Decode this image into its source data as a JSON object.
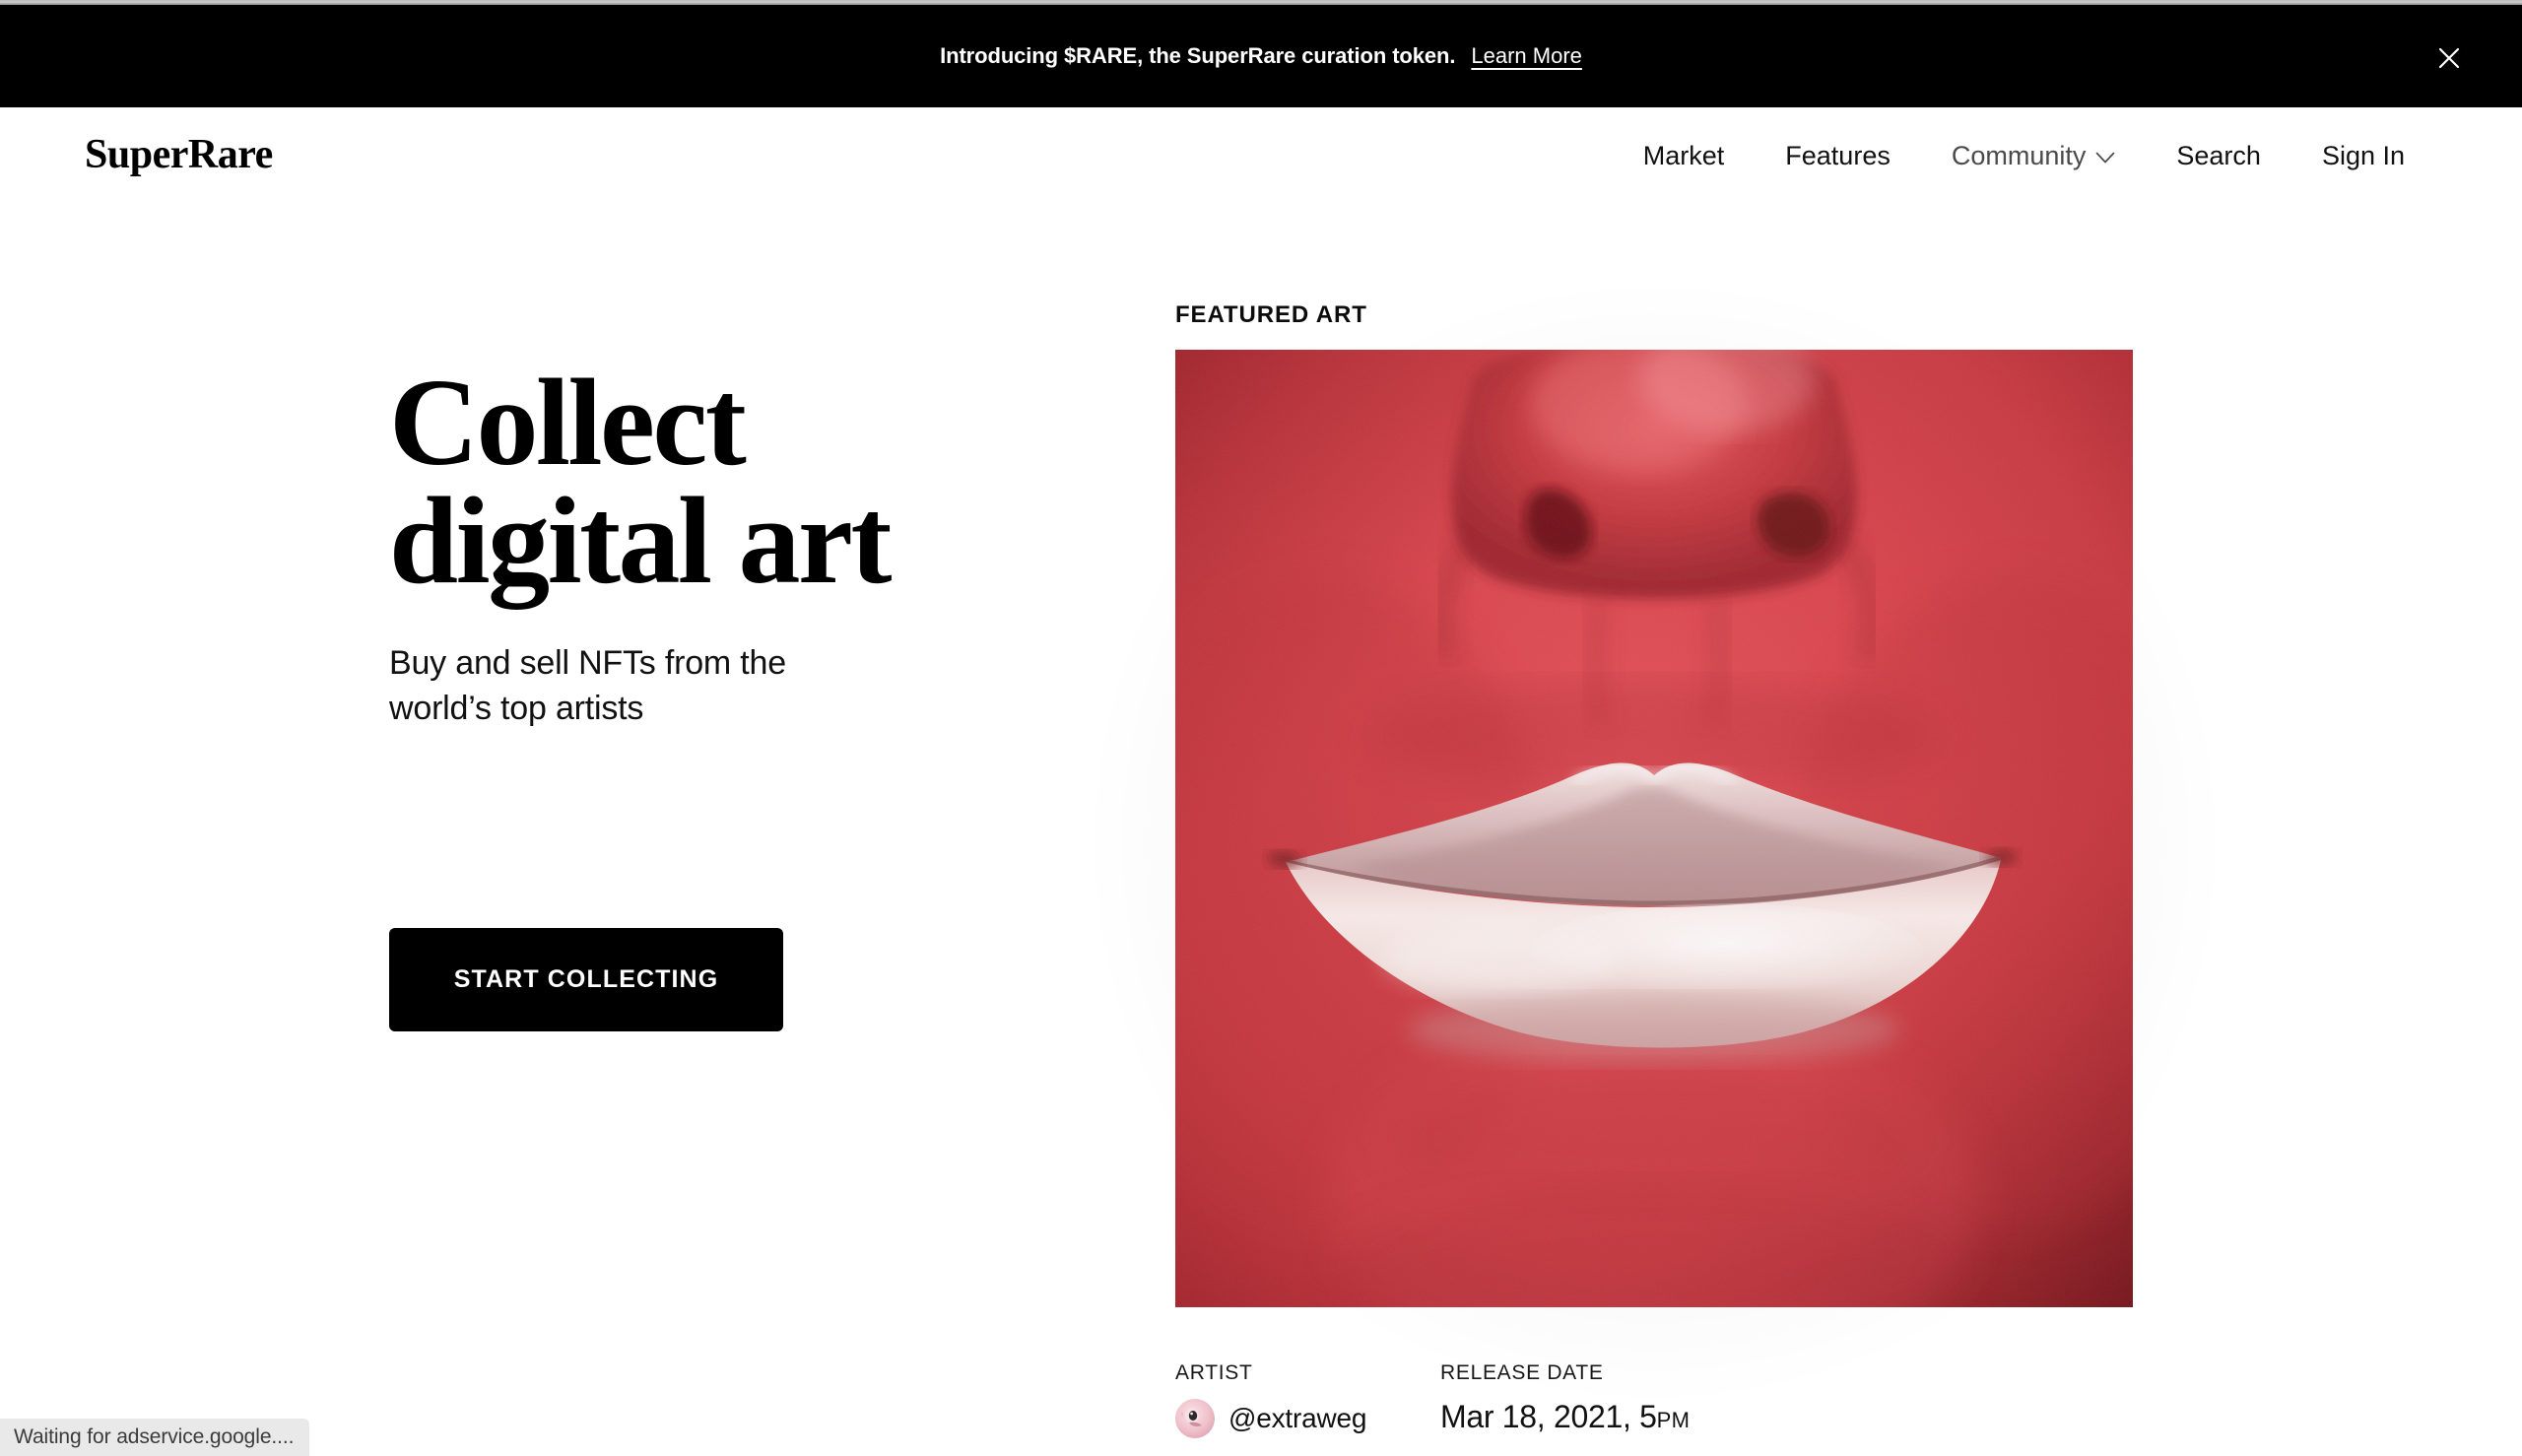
{
  "banner": {
    "text": "Introducing $RARE, the SuperRare curation token.",
    "link_label": "Learn More",
    "close_icon": "close-icon",
    "background": "#000000",
    "foreground": "#ffffff"
  },
  "header": {
    "logo": "SuperRare",
    "nav": [
      {
        "label": "Market",
        "icon": null,
        "muted": false
      },
      {
        "label": "Features",
        "icon": null,
        "muted": false
      },
      {
        "label": "Community",
        "icon": "chevron-down-icon",
        "muted": true
      },
      {
        "label": "Search",
        "icon": null,
        "muted": false
      },
      {
        "label": "Sign In",
        "icon": null,
        "muted": false
      }
    ]
  },
  "hero": {
    "title_line1": "Collect",
    "title_line2": "digital art",
    "subtitle_line1": "Buy and sell NFTs from the",
    "subtitle_line2": "world’s top artists",
    "cta_label": "START COLLECTING"
  },
  "featured": {
    "label": "FEATURED ART",
    "artwork_alt": "Close-up of a face in red tones showing nose and pale lips",
    "artist_label": "ARTIST",
    "artist_handle": "@extraweg",
    "release_label": "RELEASE DATE",
    "release_date": "Mar 18, 2021, 5",
    "release_ampm": "PM"
  },
  "status_bar": {
    "text": "Waiting for adservice.google...."
  },
  "colors": {
    "accent": "#000000",
    "page_background": "#ffffff",
    "artwork_red": "#cf3b44",
    "status_background": "#e9e9ea"
  }
}
